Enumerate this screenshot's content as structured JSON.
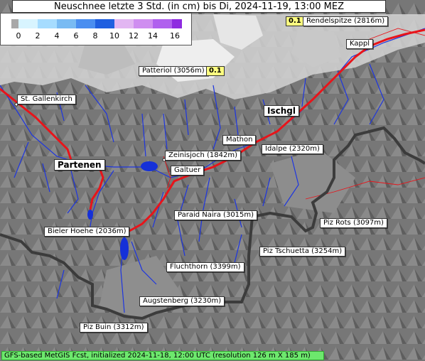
{
  "title": "Neuschnee letzte 3 Std. (in cm) bis Di, 2024-11-19, 13:00 MEZ",
  "legend": {
    "ticks": [
      "0",
      "2",
      "4",
      "6",
      "8",
      "10",
      "12",
      "14",
      "16"
    ],
    "colors": [
      "#a8a8a8",
      "#d8f4ff",
      "#a6dcff",
      "#79bbf3",
      "#4a8ef0",
      "#1f5fe0",
      "#e2b6f2",
      "#cf8ef0",
      "#b060ee",
      "#8e2be0"
    ]
  },
  "places": {
    "rendelspitze": "Rendelspitze (2816m)",
    "kappl": "Kappl",
    "patteriol": "Patteriol (3056m)",
    "st_gallenkirch": "St. Gallenkirch",
    "ischgl": "Ischgl",
    "mathon": "Mathon",
    "idalpe": "Idalpe (2320m)",
    "zeinisjoch": "Zeinisjoch (1842m)",
    "partenen": "Partenen",
    "galtuer": "Galtuer",
    "paraid_naira": "Paraid Naira (3015m)",
    "piz_rots": "Piz Rots (3097m)",
    "bieler_hoehe": "Bieler Hoehe (2036m)",
    "piz_tschuetta": "Piz Tschuetta (3254m)",
    "fluchthorn": "Fluchthorn (3399m)",
    "augstenberg": "Augstenberg (3230m)",
    "piz_buin": "Piz Buin (3312m)"
  },
  "values": {
    "rendelspitze": "0.1",
    "patteriol": "0.1"
  },
  "footer": "GFS-based MetGIS Fcst, initialized 2024-11-18, 12:00 UTC  (resolution 126 m X 185 m)",
  "colors": {
    "road": "#e8141a",
    "river": "#1d35e0",
    "border": "#3c3c3c",
    "lake": "#1530d8",
    "value_box": "#ffff80",
    "footer": "#6de86d"
  }
}
